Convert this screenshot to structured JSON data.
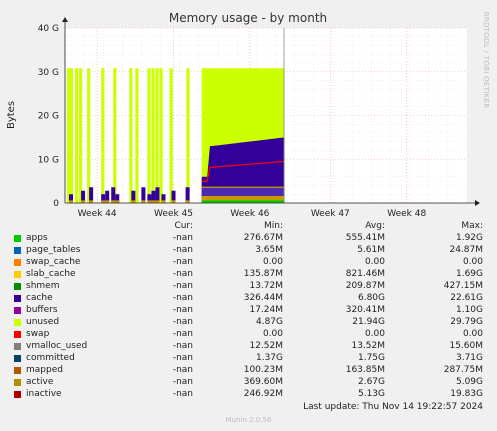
{
  "chart_data": {
    "type": "area",
    "title": "Memory usage - by month",
    "ylabel": "Bytes",
    "side_label": "RRDTOOL / TOBI OETIKER",
    "y_ticks": [
      "0",
      "10 G",
      "20 G",
      "30 G",
      "40 G"
    ],
    "y_tick_values": [
      0,
      10,
      20,
      30,
      40
    ],
    "ylim": [
      0,
      40
    ],
    "x_ticks": [
      "Week 44",
      "Week 45",
      "Week 46",
      "Week 47",
      "Week 48"
    ],
    "x_tick_positions": [
      0.08,
      0.27,
      0.46,
      0.66,
      0.85
    ],
    "now_marker": 0.5,
    "grid": true,
    "series_colors": {
      "unused": "#ccff00",
      "cache": "#330099",
      "swap": "#ff0000",
      "apps": "#00cc00",
      "active": "#cc9900",
      "inactive": "#aa0000",
      "committed": "#004466"
    },
    "approx_levels_gb_recent": {
      "total": 30.8,
      "cache_top": 15.0,
      "swap_line": 9.5,
      "committed_line": 3.6
    }
  },
  "legend": {
    "headers": {
      "cur": "Cur:",
      "min": "Min:",
      "avg": "Avg:",
      "max": "Max:"
    },
    "rows": [
      {
        "name": "apps",
        "color": "#00cc00",
        "cur": "-nan",
        "min": "276.67M",
        "avg": "555.41M",
        "max": "1.92G"
      },
      {
        "name": "page_tables",
        "color": "#0066b3",
        "cur": "-nan",
        "min": "3.65M",
        "avg": "5.61M",
        "max": "24.87M"
      },
      {
        "name": "swap_cache",
        "color": "#ff8000",
        "cur": "-nan",
        "min": "0.00",
        "avg": "0.00",
        "max": "0.00"
      },
      {
        "name": "slab_cache",
        "color": "#ffcc00",
        "cur": "-nan",
        "min": "135.87M",
        "avg": "821.46M",
        "max": "1.69G"
      },
      {
        "name": "shmem",
        "color": "#008f00",
        "cur": "-nan",
        "min": "13.72M",
        "avg": "209.87M",
        "max": "427.15M"
      },
      {
        "name": "cache",
        "color": "#330099",
        "cur": "-nan",
        "min": "326.44M",
        "avg": "6.80G",
        "max": "22.61G"
      },
      {
        "name": "buffers",
        "color": "#990099",
        "cur": "-nan",
        "min": "17.24M",
        "avg": "320.41M",
        "max": "1.10G"
      },
      {
        "name": "unused",
        "color": "#ccff00",
        "cur": "-nan",
        "min": "4.87G",
        "avg": "21.94G",
        "max": "29.79G"
      },
      {
        "name": "swap",
        "color": "#ff0000",
        "cur": "-nan",
        "min": "0.00",
        "avg": "0.00",
        "max": "0.00"
      },
      {
        "name": "vmalloc_used",
        "color": "#808080",
        "cur": "-nan",
        "min": "12.52M",
        "avg": "13.52M",
        "max": "15.60M"
      },
      {
        "name": "committed",
        "color": "#004466",
        "cur": "-nan",
        "min": "1.37G",
        "avg": "1.75G",
        "max": "3.71G"
      },
      {
        "name": "mapped",
        "color": "#b35a00",
        "cur": "-nan",
        "min": "100.23M",
        "avg": "163.85M",
        "max": "287.75M"
      },
      {
        "name": "active",
        "color": "#b38f00",
        "cur": "-nan",
        "min": "369.60M",
        "avg": "2.67G",
        "max": "5.09G"
      },
      {
        "name": "inactive",
        "color": "#aa0000",
        "cur": "-nan",
        "min": "246.92M",
        "avg": "5.13G",
        "max": "19.83G"
      }
    ]
  },
  "last_update": "Last update: Thu Nov 14 19:22:57 2024",
  "footer": "Munin 2.0.56"
}
